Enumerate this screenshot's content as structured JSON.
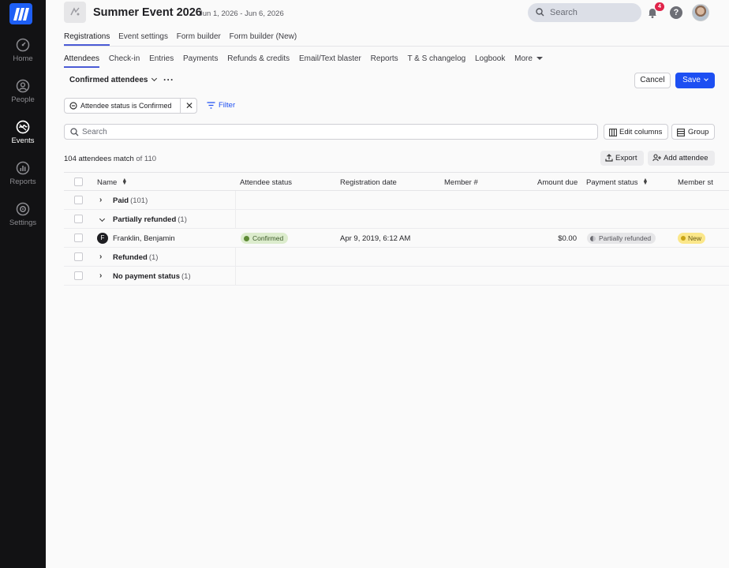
{
  "leftnav": {
    "items": [
      {
        "label": "Home",
        "icon": "speedometer-icon"
      },
      {
        "label": "People",
        "icon": "person-icon"
      },
      {
        "label": "Events",
        "icon": "events-icon"
      },
      {
        "label": "Reports",
        "icon": "bar-chart-icon"
      },
      {
        "label": "Settings",
        "icon": "gear-icon"
      }
    ],
    "active": "Events"
  },
  "header": {
    "title": "Summer Event 2026",
    "dates": "Jun 1, 2026 - Jun 6, 2026",
    "search_placeholder": "Search",
    "notification_count": "4",
    "help_glyph": "?"
  },
  "primary_tabs": [
    "Registrations",
    "Event settings",
    "Form builder",
    "Form builder (New)"
  ],
  "secondary_tabs": [
    "Attendees",
    "Check-in",
    "Entries",
    "Payments",
    "Refunds & credits",
    "Email/Text blaster",
    "Reports",
    "T & S changelog",
    "Logbook",
    "More"
  ],
  "view": {
    "selected": "Confirmed attendees",
    "more": "···",
    "cancel_label": "Cancel",
    "save_label": "Save"
  },
  "filter": {
    "chip_text": "Attendee status is Confirmed",
    "remove_glyph": "✕",
    "filter_label": "Filter"
  },
  "toolbar": {
    "search_placeholder": "Search",
    "edit_columns_label": "Edit columns",
    "group_label": "Group",
    "export_label": "Export",
    "add_attendee_label": "Add attendee"
  },
  "summary": {
    "match": "104 attendees match",
    "total": "of 110"
  },
  "table": {
    "columns": [
      "Name",
      "Attendee status",
      "Registration date",
      "Member #",
      "Amount due",
      "Payment status",
      "Member st"
    ],
    "groups": [
      {
        "label": "Paid",
        "count": "(101)",
        "expanded": false
      },
      {
        "label": "Partially refunded",
        "count": "(1)",
        "expanded": true
      },
      {
        "label": "Refunded",
        "count": "(1)",
        "expanded": false
      },
      {
        "label": "No payment status",
        "count": "(1)",
        "expanded": false
      }
    ],
    "person": {
      "initial": "F",
      "name": "Franklin, Benjamin",
      "attendee_status": "Confirmed",
      "registration_date": "Apr 9, 2019, 6:12 AM",
      "member_number": "",
      "amount_due": "$0.00",
      "payment_status": "Partially refunded",
      "member_status": "New"
    }
  },
  "colors": {
    "nav_bg": "#121214",
    "brand_blue": "#1e5ff5",
    "save_blue": "#1d4ff2",
    "tab_underline": "#4b5bd6",
    "confirmed_bg": "#dceccd",
    "new_bg": "#fbe78a"
  }
}
